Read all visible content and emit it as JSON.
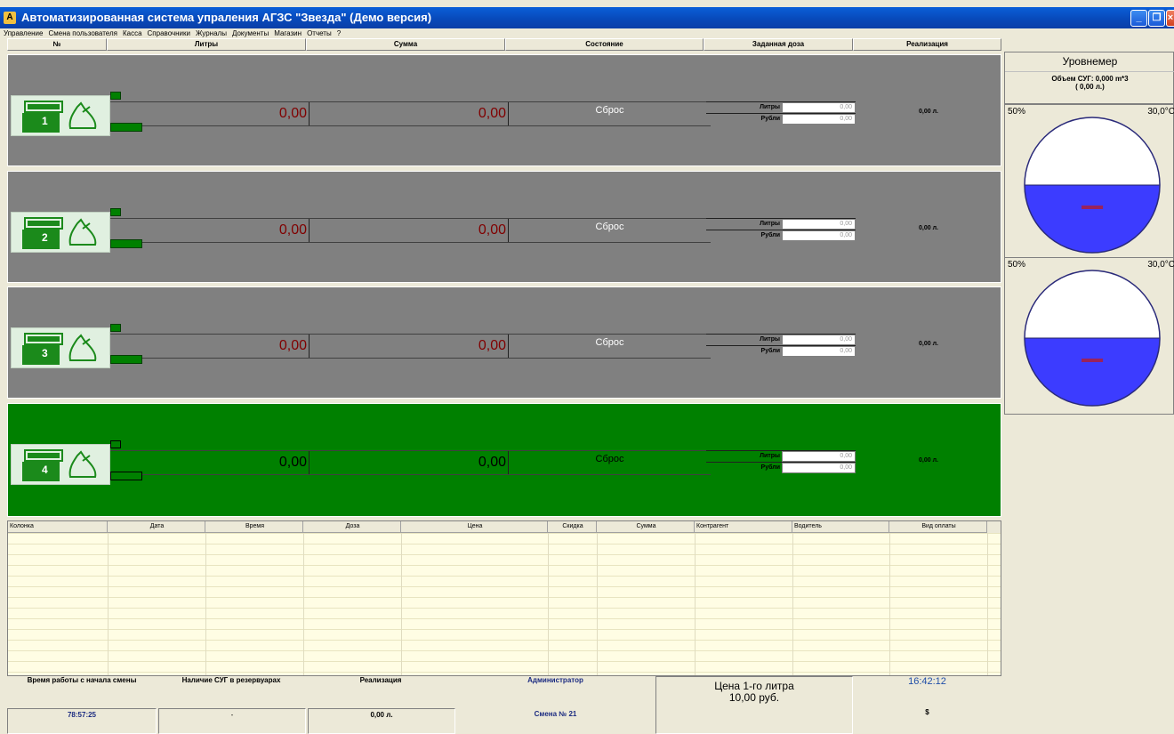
{
  "window": {
    "title": "Автоматизированная система упраления АГЗС \"Звезда\" (Демо версия)",
    "minimize_icon": "minimize-icon",
    "restore_icon": "restore-icon",
    "close_icon": "close-icon"
  },
  "menu": [
    "Управление",
    "Смена пользователя",
    "Касса",
    "Справочники",
    "Журналы",
    "Документы",
    "Магазин",
    "Отчеты",
    "?"
  ],
  "columns": [
    "№",
    "Литры",
    "Сумма",
    "Состояние",
    "Заданная доза",
    "Реализация"
  ],
  "dispensers": [
    {
      "num": "1",
      "liters": "0,00",
      "sum": "0,00",
      "state": "Сброс",
      "dose_liters_label": "Литры",
      "dose_liters": "0,00",
      "dose_rub_label": "Рубли",
      "dose_rub": "0,00",
      "realization": "0,00 л.",
      "active": false
    },
    {
      "num": "2",
      "liters": "0,00",
      "sum": "0,00",
      "state": "Сброс",
      "dose_liters_label": "Литры",
      "dose_liters": "0,00",
      "dose_rub_label": "Рубли",
      "dose_rub": "0,00",
      "realization": "0,00 л.",
      "active": false
    },
    {
      "num": "3",
      "liters": "0,00",
      "sum": "0,00",
      "state": "Сброс",
      "dose_liters_label": "Литры",
      "dose_liters": "0,00",
      "dose_rub_label": "Рубли",
      "dose_rub": "0,00",
      "realization": "0,00 л.",
      "active": false
    },
    {
      "num": "4",
      "liters": "0,00",
      "sum": "0,00",
      "state": "Сброс",
      "dose_liters_label": "Литры",
      "dose_liters": "0,00",
      "dose_rub_label": "Рубли",
      "dose_rub": "0,00",
      "realization": "0,00 л.",
      "active": true
    }
  ],
  "level_meter": {
    "title": "Уровнемер",
    "volume_line1": "Объем СУГ: 0,000 m*3",
    "volume_line2": "( 0,00 л.)",
    "tanks": [
      {
        "percent": "50%",
        "temp": "30,0°C",
        "fill_fraction": 0.5,
        "fill_color": "#3c3cff"
      },
      {
        "percent": "50%",
        "temp": "30,0°C",
        "fill_fraction": 0.5,
        "fill_color": "#3c3cff"
      }
    ]
  },
  "journal": {
    "headers": [
      "Колонка",
      "Дата",
      "Время",
      "Доза",
      "Цена",
      "Скидка",
      "Сумма",
      "Контрагент",
      "Водитель",
      "Вид оплаты"
    ]
  },
  "status": {
    "work_time_label": "Время работы с начала смены",
    "work_time": "78:57:25",
    "stock_label": "Наличие СУГ в резервуарах",
    "stock": "-",
    "realization_label": "Реализация",
    "realization": "0,00 л.",
    "user": "Администратор",
    "shift": "Смена № 21",
    "price_line1": "Цена 1-го литра",
    "price_line2": "10,00 руб.",
    "clock": "16:42:12",
    "clock_sub": "$"
  },
  "colors": {
    "panel_idle": "#808080",
    "panel_active": "#008000",
    "pump_green": "#1b8a1b",
    "clock_color": "#1f4ea8",
    "user_color": "#1a2a80"
  }
}
